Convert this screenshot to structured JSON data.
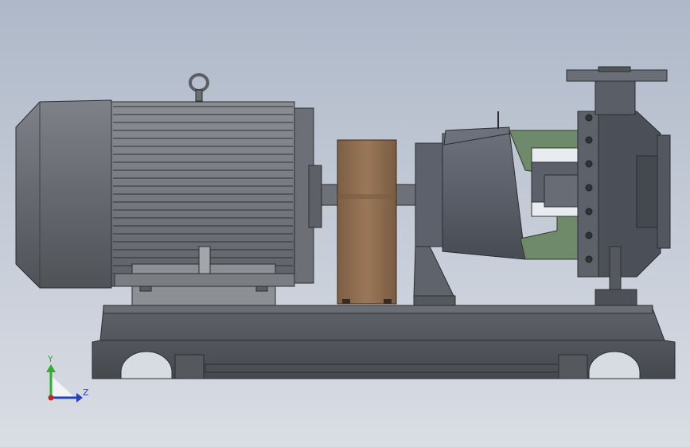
{
  "scene": {
    "background_top": "#aeb8c8",
    "background_bottom": "#d9dde4",
    "assembly": "motor-pump",
    "colors": {
      "steel": "#6d7076",
      "dark_steel": "#4d5055",
      "coupling_guard": "#8a6a4e",
      "pump_bracket": "#6f8a6b",
      "pump_body": "#5e636d"
    }
  },
  "triad": {
    "y_label": "Y",
    "z_label": "Z",
    "y_color": "#2fae2f",
    "z_color": "#2b3fb8",
    "origin_color": "#c0262a"
  }
}
